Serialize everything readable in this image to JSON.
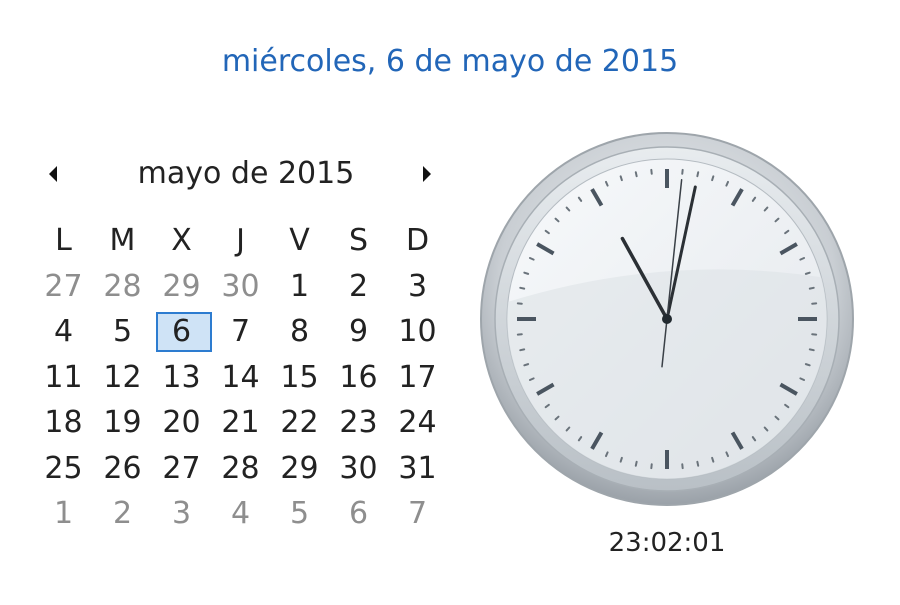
{
  "header": {
    "long_date": "miércoles, 6 de mayo de 2015"
  },
  "calendar": {
    "month_label": "mayo de 2015",
    "prev_icon": "triangle-left-icon",
    "next_icon": "triangle-right-icon",
    "weekdays": [
      "L",
      "M",
      "X",
      "J",
      "V",
      "S",
      "D"
    ],
    "weeks": [
      [
        "27",
        "28",
        "29",
        "30",
        "1",
        "2",
        "3"
      ],
      [
        "4",
        "5",
        "6",
        "7",
        "8",
        "9",
        "10"
      ],
      [
        "11",
        "12",
        "13",
        "14",
        "15",
        "16",
        "17"
      ],
      [
        "18",
        "19",
        "20",
        "21",
        "22",
        "23",
        "24"
      ],
      [
        "25",
        "26",
        "27",
        "28",
        "29",
        "30",
        "31"
      ],
      [
        "1",
        "2",
        "3",
        "4",
        "5",
        "6",
        "7"
      ]
    ],
    "selected_day": "6",
    "colors": {
      "text": "#222222",
      "other_month": "#8e8e8e",
      "today_border": "#2d7cd0",
      "today_fill": "#cfe3f6"
    }
  },
  "clock": {
    "digital_time": "23:02:01",
    "hours": 23,
    "minutes": 2,
    "seconds": 1
  }
}
